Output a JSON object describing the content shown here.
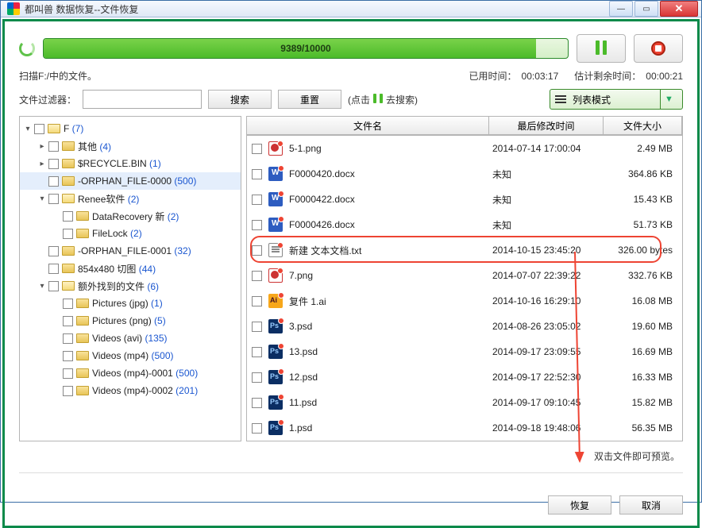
{
  "window_title": "都叫兽 数据恢复--文件恢复",
  "progress": {
    "text": "9389/10000",
    "percent": 94
  },
  "status": {
    "scanning": "扫描F:/中的文件。",
    "elapsed_label": "已用时间：",
    "elapsed": "00:03:17",
    "eta_label": "估计剩余时间：",
    "eta": "00:00:21"
  },
  "filter": {
    "label": "文件过滤器：",
    "search": "搜索",
    "reset": "重置",
    "hint_prefix": "(点击",
    "hint_suffix": "去搜索)",
    "view_mode": "列表模式"
  },
  "columns": {
    "name": "文件名",
    "date": "最后修改时间",
    "size": "文件大小"
  },
  "tree": [
    {
      "indent": 0,
      "twisty": "▾",
      "open": true,
      "label": "F",
      "count": "(7)",
      "sel": false
    },
    {
      "indent": 1,
      "twisty": "▸",
      "open": false,
      "label": "其他",
      "count": "(4)",
      "sel": false
    },
    {
      "indent": 1,
      "twisty": "▸",
      "open": false,
      "label": "$RECYCLE.BIN",
      "count": "(1)",
      "sel": false
    },
    {
      "indent": 1,
      "twisty": "",
      "open": false,
      "label": "-ORPHAN_FILE-0000",
      "count": "(500)",
      "sel": true
    },
    {
      "indent": 1,
      "twisty": "▾",
      "open": true,
      "label": "Renee软件",
      "count": "(2)",
      "sel": false
    },
    {
      "indent": 2,
      "twisty": "",
      "open": false,
      "label": "DataRecovery 新",
      "count": "(2)",
      "sel": false
    },
    {
      "indent": 2,
      "twisty": "",
      "open": false,
      "label": "FileLock",
      "count": "(2)",
      "sel": false
    },
    {
      "indent": 1,
      "twisty": "",
      "open": false,
      "label": "-ORPHAN_FILE-0001",
      "count": "(32)",
      "sel": false
    },
    {
      "indent": 1,
      "twisty": "",
      "open": false,
      "label": "854x480 切图",
      "count": "(44)",
      "sel": false
    },
    {
      "indent": 1,
      "twisty": "▾",
      "open": true,
      "label": "额外找到的文件",
      "count": "(6)",
      "sel": false
    },
    {
      "indent": 2,
      "twisty": "",
      "open": false,
      "label": "Pictures (jpg)",
      "count": "(1)",
      "sel": false
    },
    {
      "indent": 2,
      "twisty": "",
      "open": false,
      "label": "Pictures (png)",
      "count": "(5)",
      "sel": false
    },
    {
      "indent": 2,
      "twisty": "",
      "open": false,
      "label": "Videos (avi)",
      "count": "(135)",
      "sel": false
    },
    {
      "indent": 2,
      "twisty": "",
      "open": false,
      "label": "Videos (mp4)",
      "count": "(500)",
      "sel": false
    },
    {
      "indent": 2,
      "twisty": "",
      "open": false,
      "label": "Videos (mp4)-0001",
      "count": "(500)",
      "trunc": true,
      "sel": false
    },
    {
      "indent": 2,
      "twisty": "",
      "open": false,
      "label": "Videos (mp4)-0002",
      "count": "(201)",
      "trunc": true,
      "sel": false
    }
  ],
  "files": [
    {
      "icon": "png",
      "name": "5-1.png",
      "date": "2014-07-14 17:00:04",
      "size": "2.49 MB"
    },
    {
      "icon": "doc",
      "name": "F0000420.docx",
      "date": "未知",
      "size": "364.86 KB"
    },
    {
      "icon": "doc",
      "name": "F0000422.docx",
      "date": "未知",
      "size": "15.43 KB"
    },
    {
      "icon": "doc",
      "name": "F0000426.docx",
      "date": "未知",
      "size": "51.73 KB"
    },
    {
      "icon": "txt",
      "name": "新建 文本文档.txt",
      "date": "2014-10-15 23:45:20",
      "size": "326.00 bytes",
      "highlight": true
    },
    {
      "icon": "png",
      "name": "7.png",
      "date": "2014-07-07 22:39:22",
      "size": "332.76 KB"
    },
    {
      "icon": "ai",
      "name": "复件 1.ai",
      "date": "2014-10-16 16:29:10",
      "size": "16.08 MB"
    },
    {
      "icon": "psd",
      "name": "3.psd",
      "date": "2014-08-26 23:05:02",
      "size": "19.60 MB"
    },
    {
      "icon": "psd",
      "name": "13.psd",
      "date": "2014-09-17 23:09:55",
      "size": "16.69 MB"
    },
    {
      "icon": "psd",
      "name": "12.psd",
      "date": "2014-09-17 22:52:30",
      "size": "16.33 MB"
    },
    {
      "icon": "psd",
      "name": "11.psd",
      "date": "2014-09-17 09:10:45",
      "size": "15.82 MB"
    },
    {
      "icon": "psd",
      "name": "1.psd",
      "date": "2014-09-18 19:48:06",
      "size": "56.35 MB"
    }
  ],
  "footer_hint": "双击文件即可预览。",
  "buttons": {
    "recover": "恢复",
    "cancel": "取消"
  }
}
